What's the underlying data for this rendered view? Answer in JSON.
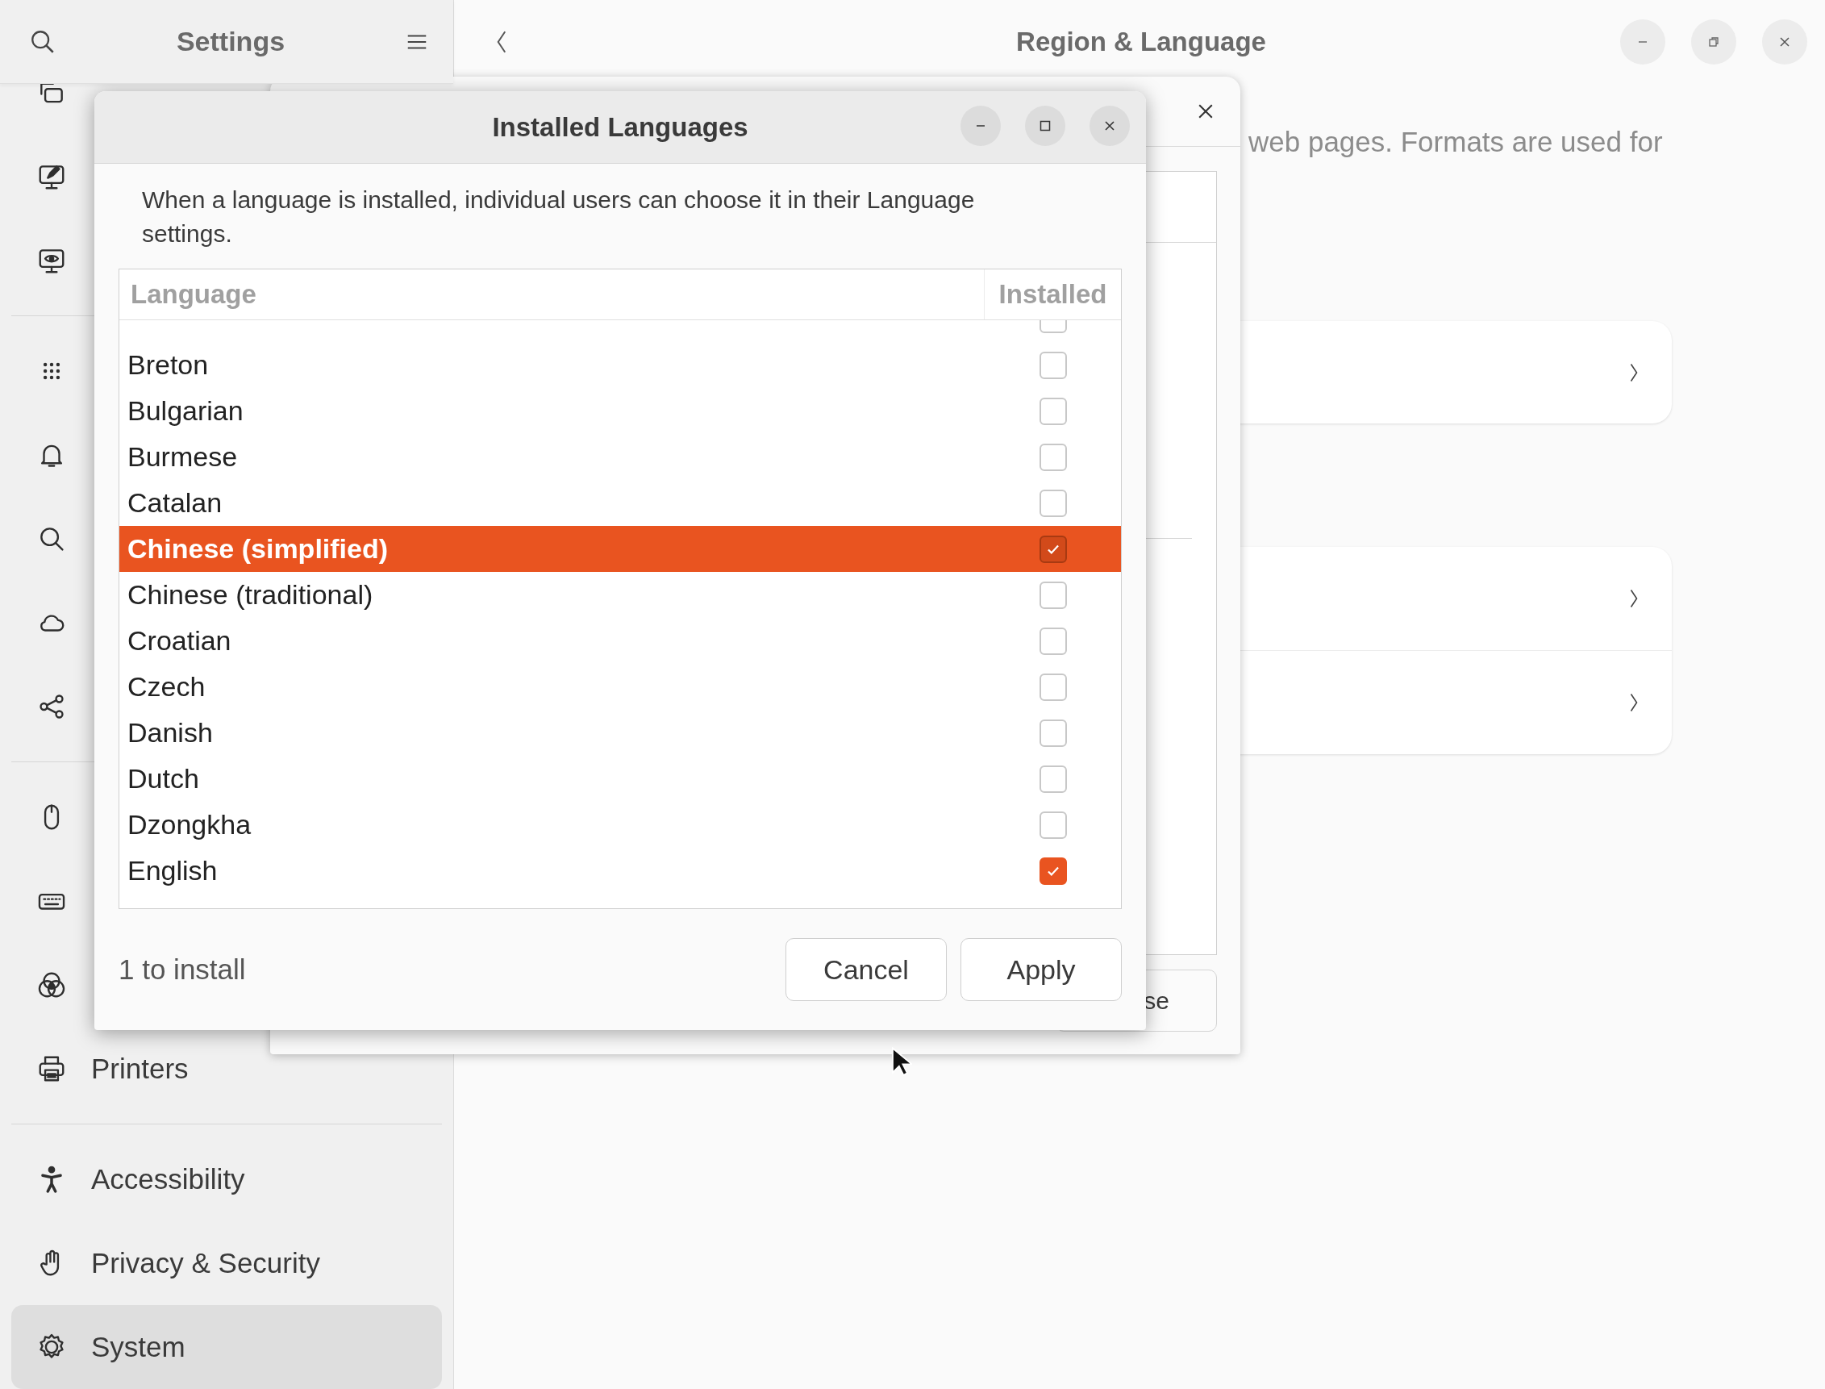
{
  "settings_window": {
    "sidebar_title": "Settings",
    "page_title": "Region & Language",
    "page_text": "web pages. Formats are used for",
    "sidebar": [
      {
        "selected": false
      },
      {
        "selected": false
      },
      {
        "selected": false
      },
      {
        "selected": false
      },
      {
        "selected": false
      },
      {
        "selected": false
      },
      {
        "selected": false
      },
      {
        "selected": false
      },
      {
        "selected": false
      },
      {
        "selected": false
      },
      {
        "selected": false
      },
      {
        "label": "Printers",
        "selected": false
      },
      {
        "label": "Accessibility",
        "selected": false
      },
      {
        "label": "Privacy & Security",
        "selected": false
      },
      {
        "label": "System",
        "selected": true
      }
    ]
  },
  "background_dialog": {
    "button_text": "se"
  },
  "dialog": {
    "title": "Installed Languages",
    "description": "When a language is installed, individual users can choose it in their Language settings.",
    "columns": [
      "Language",
      "Installed"
    ],
    "rows": [
      {
        "installed": false,
        "selected": false
      },
      {
        "language": "Breton",
        "installed": false,
        "selected": false
      },
      {
        "language": "Bulgarian",
        "installed": false,
        "selected": false
      },
      {
        "language": "Burmese",
        "installed": false,
        "selected": false
      },
      {
        "language": "Catalan",
        "installed": false,
        "selected": false
      },
      {
        "language": "Chinese (simplified)",
        "installed": true,
        "selected": true
      },
      {
        "language": "Chinese (traditional)",
        "installed": false,
        "selected": false
      },
      {
        "language": "Croatian",
        "installed": false,
        "selected": false
      },
      {
        "language": "Czech",
        "installed": false,
        "selected": false
      },
      {
        "language": "Danish",
        "installed": false,
        "selected": false
      },
      {
        "language": "Dutch",
        "installed": false,
        "selected": false
      },
      {
        "language": "Dzongkha",
        "installed": false,
        "selected": false
      },
      {
        "language": "English",
        "installed": true,
        "selected": false
      }
    ],
    "status": "1 to install",
    "buttons": [
      "Cancel",
      "Apply"
    ]
  }
}
